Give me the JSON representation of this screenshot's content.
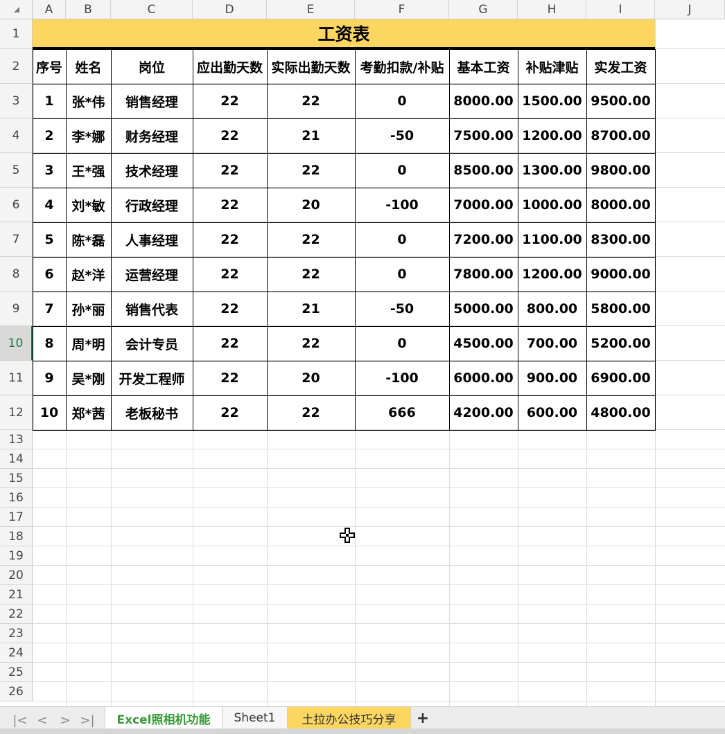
{
  "columns": [
    "A",
    "B",
    "C",
    "D",
    "E",
    "F",
    "G",
    "H",
    "I",
    "J"
  ],
  "rows": [
    "1",
    "2",
    "3",
    "4",
    "5",
    "6",
    "7",
    "8",
    "9",
    "10",
    "11",
    "12",
    "13",
    "14",
    "15",
    "16",
    "17",
    "18",
    "19",
    "20",
    "21",
    "22",
    "23",
    "24",
    "25",
    "26"
  ],
  "active_row": "10",
  "table": {
    "title": "工资表",
    "headers": [
      "序号",
      "姓名",
      "岗位",
      "应出勤天数",
      "实际出勤天数",
      "考勤扣款/补贴",
      "基本工资",
      "补贴津贴",
      "实发工资"
    ],
    "data": [
      [
        "1",
        "张*伟",
        "销售经理",
        "22",
        "22",
        "0",
        "8000.00",
        "1500.00",
        "9500.00"
      ],
      [
        "2",
        "李*娜",
        "财务经理",
        "22",
        "21",
        "-50",
        "7500.00",
        "1200.00",
        "8700.00"
      ],
      [
        "3",
        "王*强",
        "技术经理",
        "22",
        "22",
        "0",
        "8500.00",
        "1300.00",
        "9800.00"
      ],
      [
        "4",
        "刘*敏",
        "行政经理",
        "22",
        "20",
        "-100",
        "7000.00",
        "1000.00",
        "8000.00"
      ],
      [
        "5",
        "陈*磊",
        "人事经理",
        "22",
        "22",
        "0",
        "7200.00",
        "1100.00",
        "8300.00"
      ],
      [
        "6",
        "赵*洋",
        "运营经理",
        "22",
        "22",
        "0",
        "7800.00",
        "1200.00",
        "9000.00"
      ],
      [
        "7",
        "孙*丽",
        "销售代表",
        "22",
        "21",
        "-50",
        "5000.00",
        "800.00",
        "5800.00"
      ],
      [
        "8",
        "周*明",
        "会计专员",
        "22",
        "22",
        "0",
        "4500.00",
        "700.00",
        "5200.00"
      ],
      [
        "9",
        "吴*刚",
        "开发工程师",
        "22",
        "20",
        "-100",
        "6000.00",
        "900.00",
        "6900.00"
      ],
      [
        "10",
        "郑*茜",
        "老板秘书",
        "22",
        "22",
        "666",
        "4200.00",
        "600.00",
        "4800.00"
      ]
    ]
  },
  "tabs": [
    {
      "label": "Excel照相机功能",
      "state": "active"
    },
    {
      "label": "Sheet1",
      "state": "plain"
    },
    {
      "label": "土拉办公技巧分享",
      "state": "yellow"
    }
  ],
  "tab_nav": {
    "first": "|<",
    "prev": "<",
    "next": ">",
    "last": ">|",
    "add": "+"
  },
  "colors": {
    "title_fill": "#fdd661",
    "active_tab_text": "#3a9a3a",
    "gridline": "#dcdcdc"
  }
}
